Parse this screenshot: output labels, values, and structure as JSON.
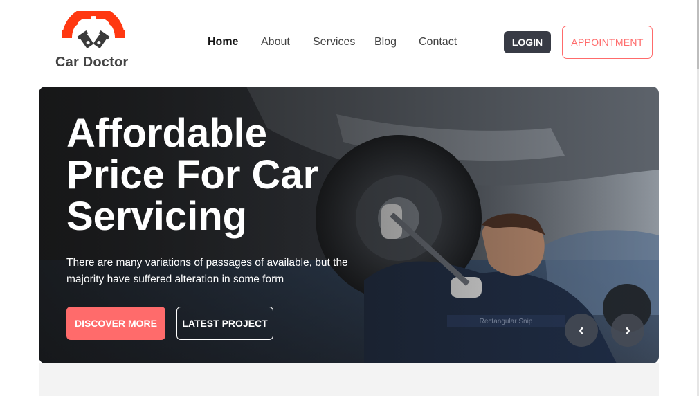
{
  "brand": {
    "name": "Car Doctor",
    "logo_icon": "gear-pistons-icon",
    "accent_color": "#ff3811"
  },
  "nav": {
    "items": [
      {
        "label": "Home",
        "active": true
      },
      {
        "label": "About",
        "active": false
      },
      {
        "label": "Services",
        "active": false
      },
      {
        "label": "Blog",
        "active": false
      },
      {
        "label": "Contact",
        "active": false
      }
    ]
  },
  "header": {
    "login_label": "LOGIN",
    "appointment_label": "APPOINTMENT"
  },
  "hero": {
    "title": "Affordable Price For Car Servicing",
    "subtitle": "There are many variations of passages of available, but the majority have suffered alteration in some form",
    "discover_label": "DISCOVER MORE",
    "project_label": "LATEST PROJECT",
    "strip_label": "Rectangular Snip",
    "prev_label": "‹",
    "next_label": "›",
    "image": "mechanic-under-car-photo"
  },
  "colors": {
    "primary": "#ff6b6b",
    "dark_button": "#383b45"
  }
}
